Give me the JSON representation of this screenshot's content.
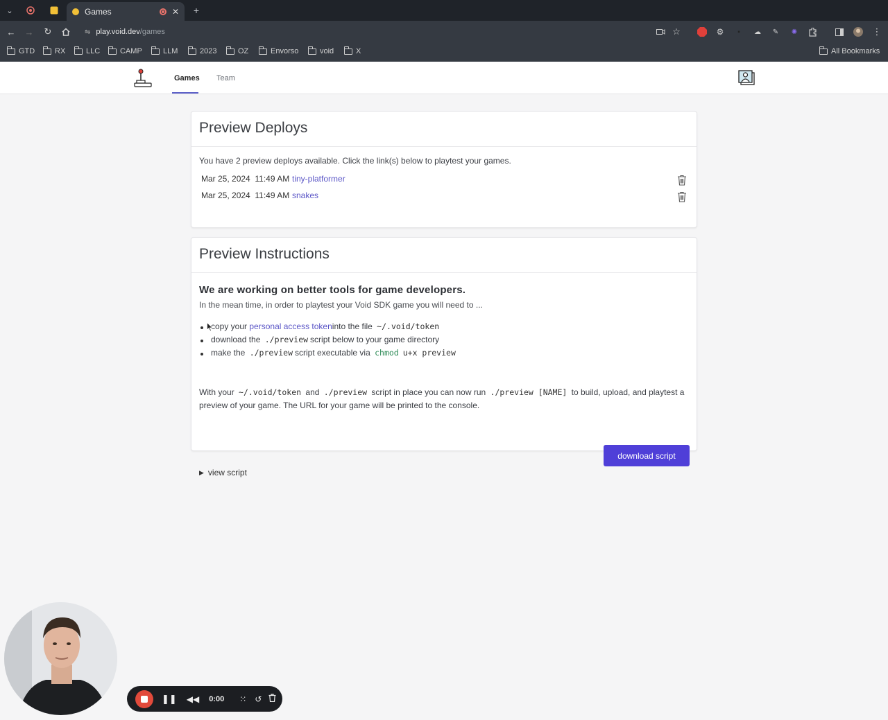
{
  "browser": {
    "tab_title": "Games",
    "url_domain": "play.void.dev",
    "url_path": "/games",
    "bookmarks": [
      "GTD",
      "RX",
      "LLC",
      "CAMP",
      "LLM",
      "2023",
      "OZ",
      "Envorso",
      "void",
      "X"
    ],
    "all_bookmarks": "All Bookmarks"
  },
  "nav": {
    "games": "Games",
    "team": "Team"
  },
  "deploys": {
    "title": "Preview Deploys",
    "intro": "You have 2 preview deploys available. Click the link(s) below to playtest your games.",
    "rows": [
      {
        "date": "Mar 25, 2024  11:49 AM",
        "name": "tiny-platformer"
      },
      {
        "date": "Mar 25, 2024  11:49 AM",
        "name": "snakes"
      }
    ]
  },
  "instructions": {
    "title": "Preview Instructions",
    "heading": "We are working on better tools for game developers.",
    "lead": "In the mean time, in order to playtest your Void SDK game you will need to ...",
    "step1_a": "copy your",
    "step1_link": "personal access token",
    "step1_b": "into the file",
    "step1_code": "~/.void/token",
    "step2_a": "download the",
    "step2_code": "./preview",
    "step2_b": "script below to your game directory",
    "step3_a": "make the",
    "step3_code": "./preview",
    "step3_b": "script executable via",
    "step3_cmd1": "chmod",
    "step3_cmd2": "u+x preview",
    "para_a": "With your",
    "para_code1": "~/.void/token",
    "para_and": "and",
    "para_code2": "./preview",
    "para_b": "script in place you can now run",
    "para_code3": "./preview [NAME]",
    "para_c": "to build, upload, and playtest a",
    "para_d": "preview of your game. The URL for your game will be printed to the console.",
    "download": "download script",
    "view_script": "view script"
  },
  "recorder": {
    "time": "0:00"
  },
  "colors": {
    "accent": "#4f3fd8",
    "link": "#5a55c6",
    "record": "#e24a3b"
  }
}
